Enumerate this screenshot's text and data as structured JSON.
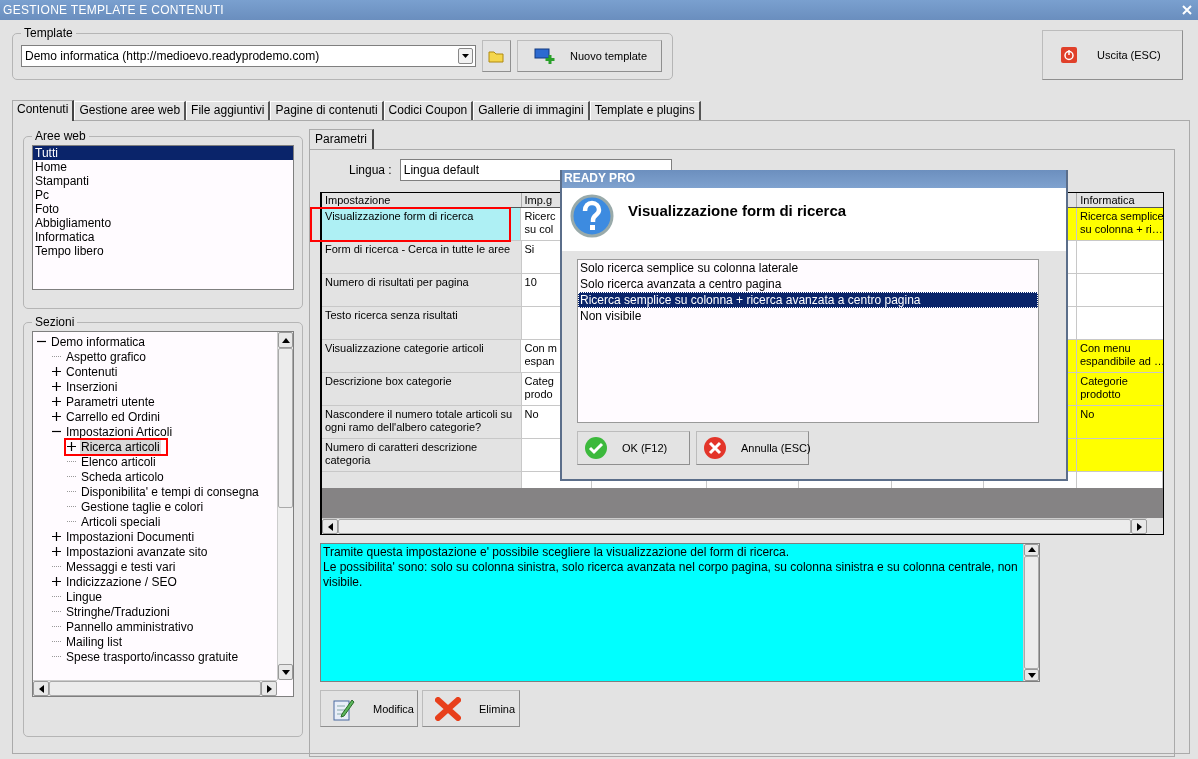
{
  "window": {
    "title": "GESTIONE TEMPLATE E CONTENUTI"
  },
  "template": {
    "label": "Template",
    "value": "Demo informatica (http://medioevo.readyprodemo.com)",
    "new_button": "Nuovo template"
  },
  "exit_button": "Uscita (ESC)",
  "tabs": [
    {
      "label": "Contenuti",
      "selected": true
    },
    {
      "label": "Gestione aree web",
      "selected": false
    },
    {
      "label": "File aggiuntivi",
      "selected": false
    },
    {
      "label": "Pagine di contenuti",
      "selected": false
    },
    {
      "label": "Codici Coupon",
      "selected": false
    },
    {
      "label": "Gallerie di immagini",
      "selected": false
    },
    {
      "label": "Template e plugins",
      "selected": false
    }
  ],
  "web_areas": {
    "label": "Aree web",
    "items": [
      {
        "label": "Tutti",
        "selected": true
      },
      {
        "label": "Home",
        "selected": false
      },
      {
        "label": "Stampanti",
        "selected": false
      },
      {
        "label": "Pc",
        "selected": false
      },
      {
        "label": "Foto",
        "selected": false
      },
      {
        "label": "Abbigliamento",
        "selected": false
      },
      {
        "label": "Informatica",
        "selected": false
      },
      {
        "label": "Tempo libero",
        "selected": false
      }
    ]
  },
  "sections": {
    "label": "Sezioni",
    "tree": [
      {
        "label": "Demo informatica",
        "kind": "branch",
        "expanded": true,
        "selected": false,
        "children": [
          {
            "label": "Aspetto grafico",
            "kind": "leaf",
            "expanded": false,
            "selected": false
          },
          {
            "label": "Contenuti",
            "kind": "branch",
            "expanded": false,
            "selected": false
          },
          {
            "label": "Inserzioni",
            "kind": "branch",
            "expanded": false,
            "selected": false
          },
          {
            "label": "Parametri utente",
            "kind": "branch",
            "expanded": false,
            "selected": false
          },
          {
            "label": "Carrello ed Ordini",
            "kind": "branch",
            "expanded": false,
            "selected": false
          },
          {
            "label": "Impostazioni Articoli",
            "kind": "branch",
            "expanded": true,
            "selected": false,
            "children": [
              {
                "label": "Ricerca articoli",
                "kind": "branch",
                "expanded": false,
                "selected": true
              },
              {
                "label": "Elenco articoli",
                "kind": "leaf",
                "expanded": false,
                "selected": false
              },
              {
                "label": "Scheda articolo",
                "kind": "leaf",
                "expanded": false,
                "selected": false
              },
              {
                "label": "Disponibilita' e tempi di consegna",
                "kind": "leaf",
                "expanded": false,
                "selected": false
              },
              {
                "label": "Gestione taglie e colori",
                "kind": "leaf",
                "expanded": false,
                "selected": false
              },
              {
                "label": "Articoli speciali",
                "kind": "leaf",
                "expanded": false,
                "selected": false
              }
            ]
          },
          {
            "label": "Impostazioni Documenti",
            "kind": "branch",
            "expanded": false,
            "selected": false
          },
          {
            "label": "Impostazioni avanzate sito",
            "kind": "branch",
            "expanded": false,
            "selected": false
          },
          {
            "label": "Messaggi e testi vari",
            "kind": "leaf",
            "expanded": false,
            "selected": false
          },
          {
            "label": "Indicizzazione / SEO",
            "kind": "branch",
            "expanded": false,
            "selected": false
          },
          {
            "label": "Lingue",
            "kind": "leaf",
            "expanded": false,
            "selected": false
          },
          {
            "label": "Stringhe/Traduzioni",
            "kind": "leaf",
            "expanded": false,
            "selected": false
          },
          {
            "label": "Pannello amministrativo",
            "kind": "leaf",
            "expanded": false,
            "selected": false
          },
          {
            "label": "Mailing list",
            "kind": "leaf",
            "expanded": false,
            "selected": false
          },
          {
            "label": "Spese trasporto/incasso gratuite",
            "kind": "leaf",
            "expanded": false,
            "selected": false
          }
        ]
      }
    ]
  },
  "sub_tabs": [
    {
      "label": "Parametri",
      "selected": true
    }
  ],
  "language": {
    "label": "Lingua :",
    "value": "Lingua default"
  },
  "table": {
    "columns": [
      "Impostazione",
      "Imp.g",
      "Informatica"
    ],
    "rows": [
      {
        "setting": "Visualizzazione form di ricerca",
        "column_2": [
          "Ricerc",
          "su col"
        ],
        "informatica": [
          "Ricerca semplice",
          "su colonna + ri…"
        ],
        "highlighted": true,
        "selected": true
      },
      {
        "setting": "Form di ricerca - Cerca in tutte le aree",
        "column_2": [
          "Si"
        ],
        "informatica": [],
        "highlighted": false,
        "selected": false
      },
      {
        "setting": "Numero di risultati per pagina",
        "column_2": [
          "10"
        ],
        "informatica": [],
        "highlighted": false,
        "selected": false
      },
      {
        "setting": "Testo ricerca senza risultati",
        "column_2": [],
        "informatica": [],
        "highlighted": false,
        "selected": false
      },
      {
        "setting": "Visualizzazione categorie articoli",
        "column_2": [
          "Con m",
          "espan"
        ],
        "informatica": [
          "Con menu",
          "espandibile ad …"
        ],
        "highlighted": true,
        "selected": false
      },
      {
        "setting": "Descrizione box categorie",
        "column_2": [
          "Categ",
          "prodo"
        ],
        "informatica": [
          "Categorie",
          "prodotto"
        ],
        "highlighted": true,
        "selected": false
      },
      {
        "setting": "Nascondere il numero totale articoli su ogni ramo dell'albero categorie?",
        "column_2": [
          "No"
        ],
        "informatica": [
          "No"
        ],
        "highlighted": true,
        "selected": false
      },
      {
        "setting": "Numero di caratteri descrizione categoria",
        "column_2": [],
        "informatica": [],
        "highlighted": true,
        "selected": false
      }
    ]
  },
  "description": "Tramite questa impostazione e' possibile scegliere la visualizzazione del form di ricerca.\nLe possibilita' sono: solo su colonna sinistra, solo ricerca avanzata nel corpo pagina, su colonna sinistra e su colonna centrale, non visibile.",
  "actions": [
    {
      "label": "Modifica",
      "kind": "edit"
    },
    {
      "label": "Elimina",
      "kind": "delete"
    }
  ],
  "dialog": {
    "title": "READY PRO",
    "heading": "Visualizzazione form di ricerca",
    "options": [
      {
        "label": "Solo ricerca semplice su colonna laterale",
        "selected": false
      },
      {
        "label": "Solo ricerca avanzata a centro pagina",
        "selected": false
      },
      {
        "label": "Ricerca semplice su colonna + ricerca avanzata a centro pagina",
        "selected": true
      },
      {
        "label": "Non visibile",
        "selected": false
      }
    ],
    "buttons": [
      {
        "label": "OK (F12)",
        "kind": "ok"
      },
      {
        "label": "Annulla (ESC)",
        "kind": "cancel"
      }
    ]
  }
}
